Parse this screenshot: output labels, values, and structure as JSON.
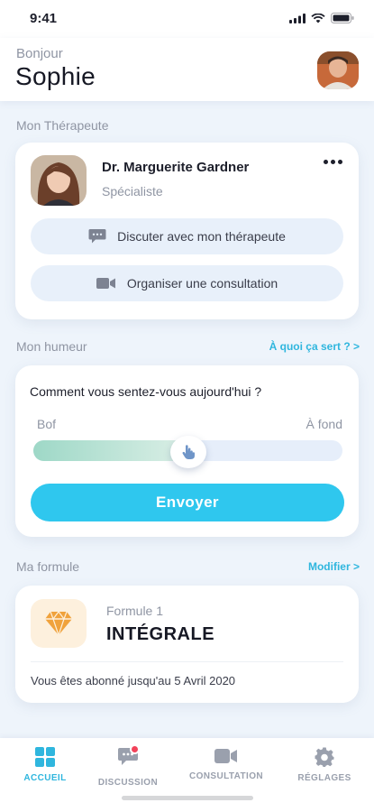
{
  "status_bar": {
    "time": "9:41"
  },
  "header": {
    "greeting": "Bonjour",
    "user_name": "Sophie"
  },
  "therapist_section": {
    "title": "Mon Thérapeute",
    "name": "Dr. Marguerite Gardner",
    "role": "Spécialiste",
    "chat_label": "Discuter avec mon thérapeute",
    "consult_label": "Organiser une consultation"
  },
  "mood_section": {
    "title": "Mon humeur",
    "link": "À quoi ça sert ? >",
    "question": "Comment vous sentez-vous aujourd'hui ?",
    "low_label": "Bof",
    "high_label": "À fond",
    "level": 0.5,
    "submit_label": "Envoyer"
  },
  "plan_section": {
    "title": "Ma formule",
    "link": "Modifier >",
    "plan_label": "Formule 1",
    "plan_name": "INTÉGRALE",
    "subscription_text": "Vous êtes abonné jusqu'au 5 Avril 2020"
  },
  "tabs": [
    {
      "label": "ACCUEIL",
      "icon": "grid-icon",
      "active": true
    },
    {
      "label": "DISCUSSION",
      "icon": "chat-bubble-icon",
      "active": false
    },
    {
      "label": "CONSULTATION",
      "icon": "video-camera-icon",
      "active": false
    },
    {
      "label": "RÉGLAGES",
      "icon": "gear-icon",
      "active": false
    }
  ],
  "colors": {
    "accent": "#2fc7ee",
    "link": "#2fb6de",
    "badge": "#f2435a",
    "diamond": "#f0a23c"
  }
}
